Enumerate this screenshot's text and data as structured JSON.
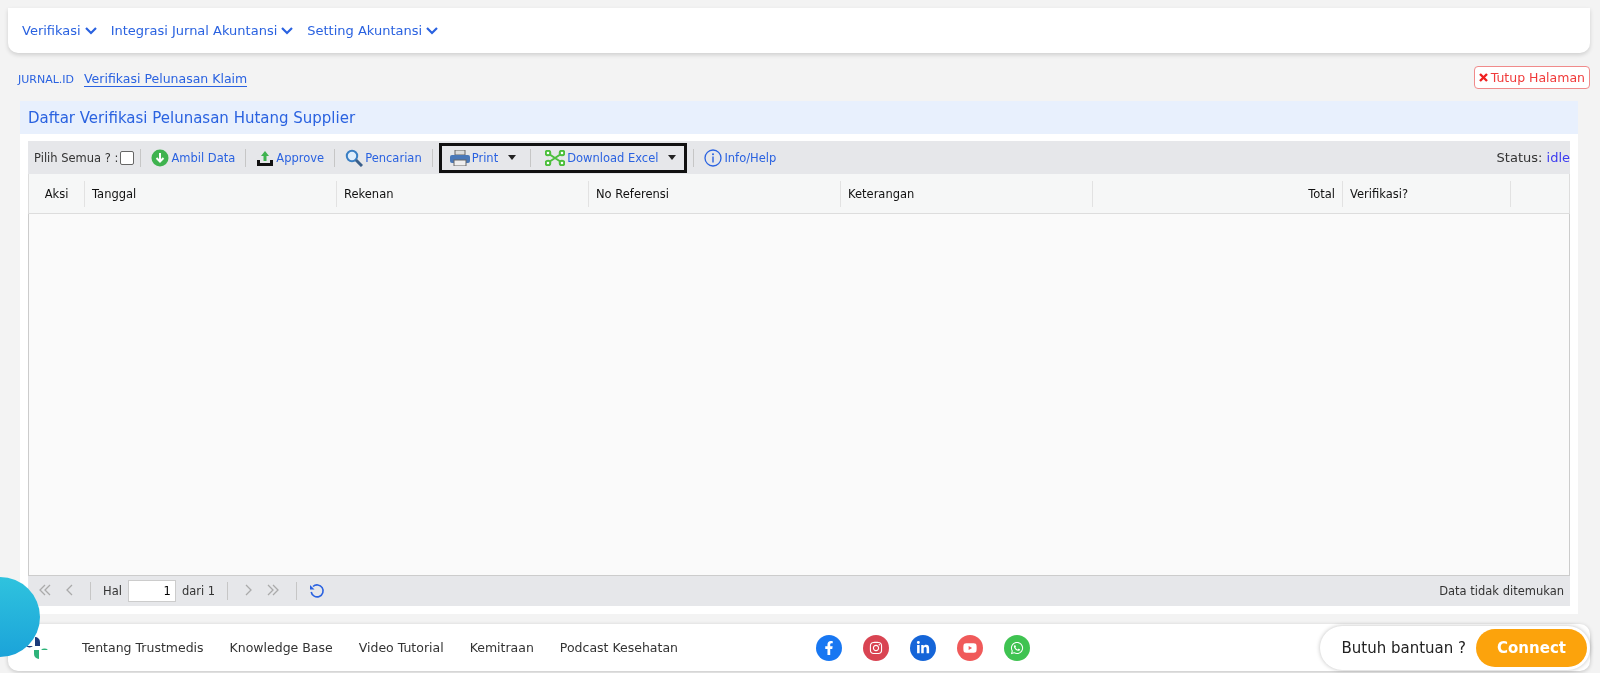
{
  "menu": [
    {
      "label": "Verifikasi"
    },
    {
      "label": "Integrasi Jurnal Akuntansi"
    },
    {
      "label": "Setting Akuntansi"
    }
  ],
  "breadcrumb": {
    "root": "JURNAL.ID",
    "current": "Verifikasi Pelunasan Klaim"
  },
  "close_button": "Tutup Halaman",
  "panel": {
    "title": "Daftar Verifikasi Pelunasan Hutang Supplier",
    "select_all": {
      "label": "Pilih Semua ? :",
      "checked": false
    },
    "toolbar": [
      {
        "kind": "download",
        "label": "Ambil Data",
        "highlighted": false
      },
      {
        "kind": "upload",
        "label": "Approve",
        "highlighted": false
      },
      {
        "kind": "search",
        "label": "Pencarian",
        "highlighted": false
      },
      {
        "kind": "print",
        "label": "Print",
        "dropdown": true,
        "highlighted": true
      },
      {
        "kind": "excel",
        "label": "Download Excel",
        "dropdown": true,
        "highlighted": true
      },
      {
        "kind": "info",
        "label": "Info/Help",
        "highlighted": false
      }
    ],
    "status": {
      "label": "Status:",
      "value": "idle"
    },
    "columns": [
      {
        "label": "Aksi",
        "kind": "action"
      },
      {
        "label": "Tanggal",
        "kind": "text"
      },
      {
        "label": "Rekenan",
        "kind": "text"
      },
      {
        "label": "No Referensi",
        "kind": "text"
      },
      {
        "label": "Keterangan",
        "kind": "text"
      },
      {
        "label": "Total",
        "kind": "number"
      },
      {
        "label": "Verifikasi?",
        "kind": "text"
      }
    ],
    "pager": {
      "page_label": "Hal",
      "page": "1",
      "of_label": "dari 1",
      "message": "Data tidak ditemukan"
    }
  },
  "footer": {
    "links": [
      "Tentang Trustmedis",
      "Knowledge Base",
      "Video Tutorial",
      "Kemitraan",
      "Podcast Kesehatan"
    ],
    "social": [
      {
        "kind": "facebook",
        "color": "#1877f2"
      },
      {
        "kind": "instagram",
        "color": "#d94452"
      },
      {
        "kind": "linkedin",
        "color": "#1565d8"
      },
      {
        "kind": "youtube",
        "color": "#f05a5a"
      },
      {
        "kind": "whatsapp",
        "color": "#3fc351"
      }
    ],
    "help_text": "Butuh bantuan ?",
    "connect": "Connect"
  }
}
